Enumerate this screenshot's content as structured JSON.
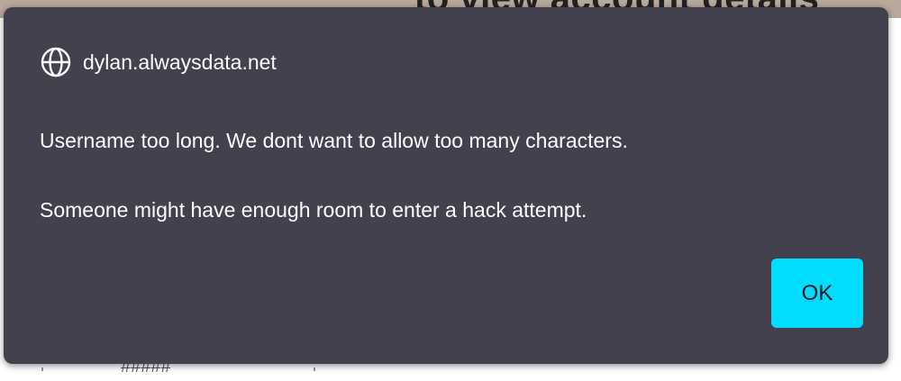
{
  "background": {
    "heading": "to view account details",
    "fragment": "#####"
  },
  "dialog": {
    "origin": "dylan.alwaysdata.net",
    "origin_icon": "globe-icon",
    "message_lines": [
      "Username too long. We dont want to allow too many characters.",
      "Someone might have enough room to enter a hack attempt."
    ],
    "ok_label": "OK"
  },
  "colors": {
    "dialog_background": "#42414d",
    "text": "#fbfbfe",
    "accent_button": "#00ddff"
  }
}
